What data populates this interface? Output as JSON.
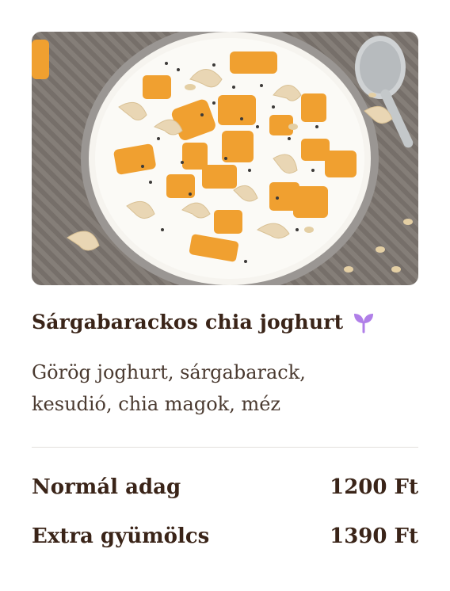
{
  "product": {
    "title": "Sárgabarackos chia joghurt",
    "vegan_icon": "sprout-icon",
    "description": "Görög joghurt, sárgabarack, kesudió, chia magok, méz",
    "image_alt": "Sárgabarackos chia joghurt"
  },
  "prices": [
    {
      "label": "Normál adag",
      "value": "1200 Ft"
    },
    {
      "label": "Extra gyümölcs",
      "value": "1390 Ft"
    }
  ],
  "colors": {
    "text": "#3a2418",
    "accent_icon": "#b07fe8",
    "divider": "#e2dfdc"
  }
}
